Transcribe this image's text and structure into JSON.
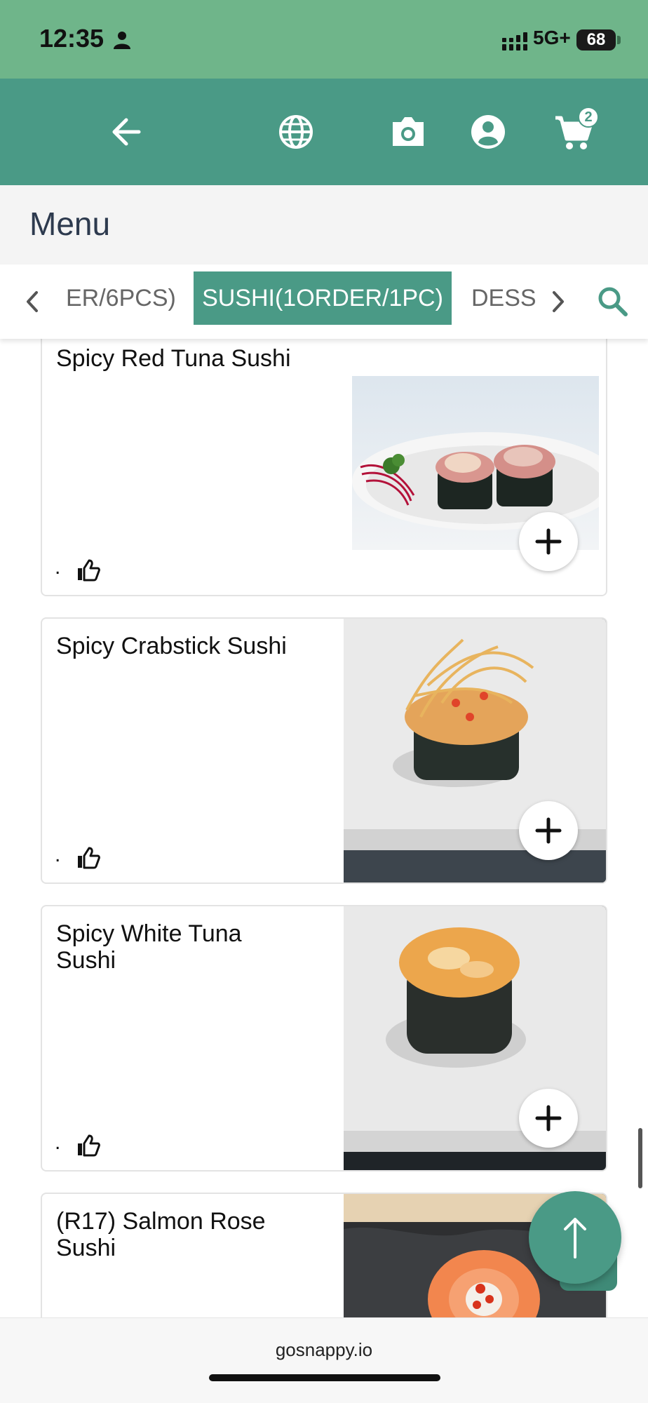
{
  "status_bar": {
    "time": "12:35",
    "network": "5G+",
    "battery": "68"
  },
  "header": {
    "cart_count": "2",
    "icons": [
      "back-arrow-icon",
      "globe-icon",
      "camera-icon",
      "account-icon",
      "cart-icon"
    ]
  },
  "page": {
    "title": "Menu"
  },
  "tabs": [
    {
      "label": "ER/6PCS)"
    },
    {
      "label": "SUSHI(1ORDER/1PC)",
      "active": true
    },
    {
      "label": "DESS"
    }
  ],
  "items": [
    {
      "name": "Spicy Red Tuna Sushi",
      "meta": "."
    },
    {
      "name": "Spicy Crabstick Sushi",
      "meta": "."
    },
    {
      "name": "Spicy White Tuna Sushi",
      "meta": "."
    },
    {
      "name": "(R17) Salmon Rose Sushi",
      "meta": "."
    }
  ],
  "footer": {
    "url": "gosnappy.io"
  },
  "colors": {
    "status_bar": "#6fb58a",
    "brand": "#4a9a86",
    "title_text": "#2d3a4e"
  }
}
